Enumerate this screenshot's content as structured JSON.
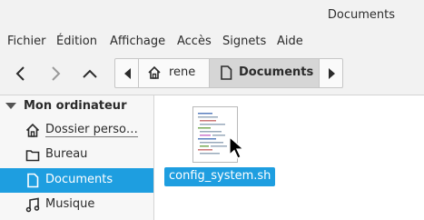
{
  "window": {
    "title": "Documents"
  },
  "menu": {
    "items": [
      "Fichier",
      "Édition",
      "Affichage",
      "Accès",
      "Signets",
      "Aide"
    ]
  },
  "toolbar": {
    "back_icon": "chevron-left-icon",
    "forward_icon": "chevron-right-icon",
    "up_icon": "chevron-up-icon"
  },
  "pathbar": {
    "segments": [
      {
        "label": "rene",
        "icon": "home-icon"
      },
      {
        "label": "Documents",
        "icon": "document-icon",
        "active": true
      }
    ]
  },
  "sidebar": {
    "header": "Mon ordinateur",
    "items": [
      {
        "label": "Dossier perso…",
        "icon": "home-icon"
      },
      {
        "label": "Bureau",
        "icon": "folder-icon"
      },
      {
        "label": "Documents",
        "icon": "document-icon",
        "active": true
      },
      {
        "label": "Musique",
        "icon": "music-icon"
      }
    ]
  },
  "files": [
    {
      "name": "config_system.sh",
      "icon": "script-file-icon",
      "selected": true
    }
  ],
  "colors": {
    "accent": "#1e9ee0",
    "chrome": "#f2f2f2"
  }
}
